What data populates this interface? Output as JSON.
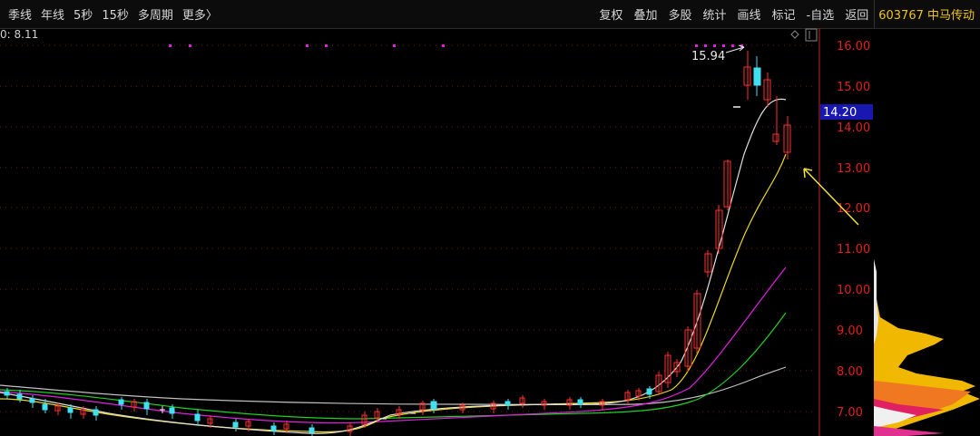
{
  "toolbar": {
    "left_items": [
      "季线",
      "年线",
      "5秒",
      "15秒",
      "多周期",
      "更多〉"
    ],
    "right_items": [
      "复权",
      "叠加",
      "多股",
      "统计",
      "画线",
      "标记",
      "-自选",
      "返回"
    ],
    "stock_label": "603767 中马传动"
  },
  "info_line": "0: 8.11",
  "price_tag": "14.20",
  "peak_label": "15.94",
  "chart_data": {
    "type": "candlestick",
    "y_ticks": [
      "16.00",
      "15.00",
      "14.00",
      "13.00",
      "12.00",
      "11.00",
      "10.00",
      "9.00",
      "8.00",
      "7.00"
    ],
    "ylim": [
      6.62,
      16.62
    ],
    "current_price": 14.2,
    "peak": 15.94,
    "colors": {
      "up": "#ff3030",
      "down": "#40e0f0",
      "ma5": "#e0e0e0",
      "ma10": "#e8d820",
      "ma20": "#e020e0",
      "ma30": "#20d020",
      "ma60": "#c0c0c0",
      "axis": "#e02020"
    }
  }
}
